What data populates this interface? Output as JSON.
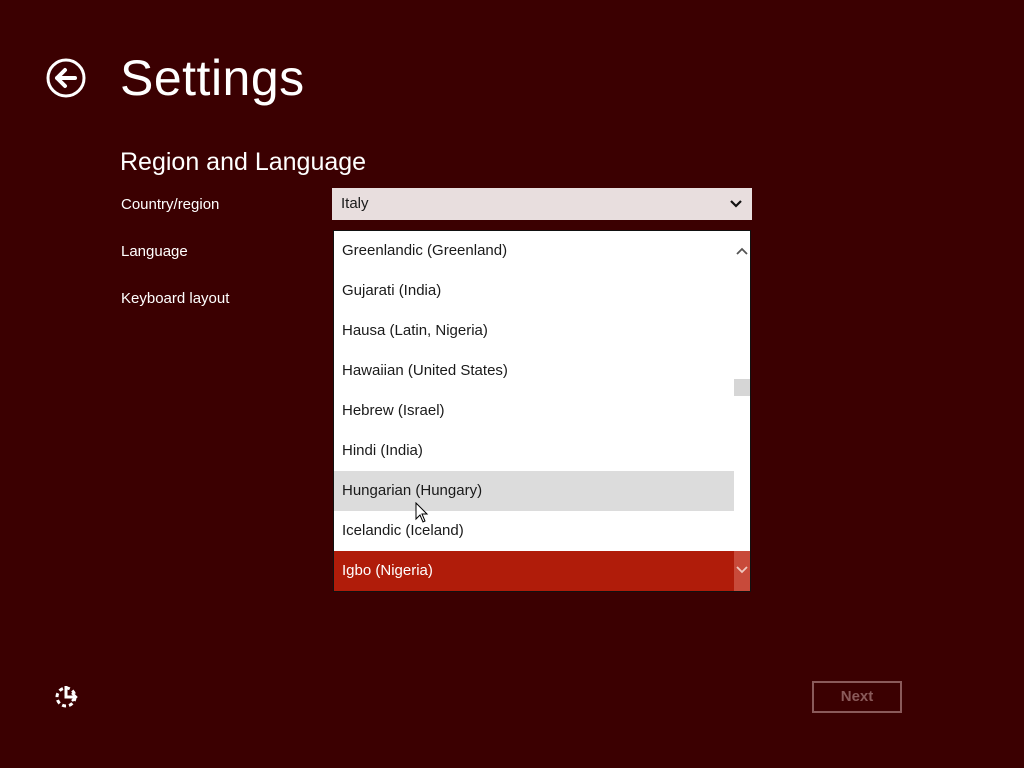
{
  "header": {
    "title": "Settings",
    "back_icon": "back-arrow-icon"
  },
  "section": {
    "title": "Region and Language"
  },
  "fields": {
    "country_label": "Country/region",
    "language_label": "Language",
    "keyboard_label": "Keyboard layout"
  },
  "country_select": {
    "value": "Italy",
    "icon": "chevron-down-icon"
  },
  "language_list": {
    "items": [
      {
        "label": "Greenlandic (Greenland)"
      },
      {
        "label": "Gujarati (India)"
      },
      {
        "label": "Hausa (Latin, Nigeria)"
      },
      {
        "label": "Hawaiian (United States)"
      },
      {
        "label": "Hebrew (Israel)"
      },
      {
        "label": "Hindi (India)"
      },
      {
        "label": "Hungarian (Hungary)"
      },
      {
        "label": "Icelandic (Iceland)"
      },
      {
        "label": "Igbo (Nigeria)"
      }
    ],
    "hovered_item": "Hungarian (Hungary)",
    "selected_item": "Igbo (Nigeria)"
  },
  "footer": {
    "ease_of_access_icon": "ease-of-access-icon",
    "next_label": "Next"
  },
  "colors": {
    "background": "#3b0001",
    "accent": "#b01c0a",
    "select_bg": "#e8dede",
    "disabled_button": "#8a5a5a"
  }
}
